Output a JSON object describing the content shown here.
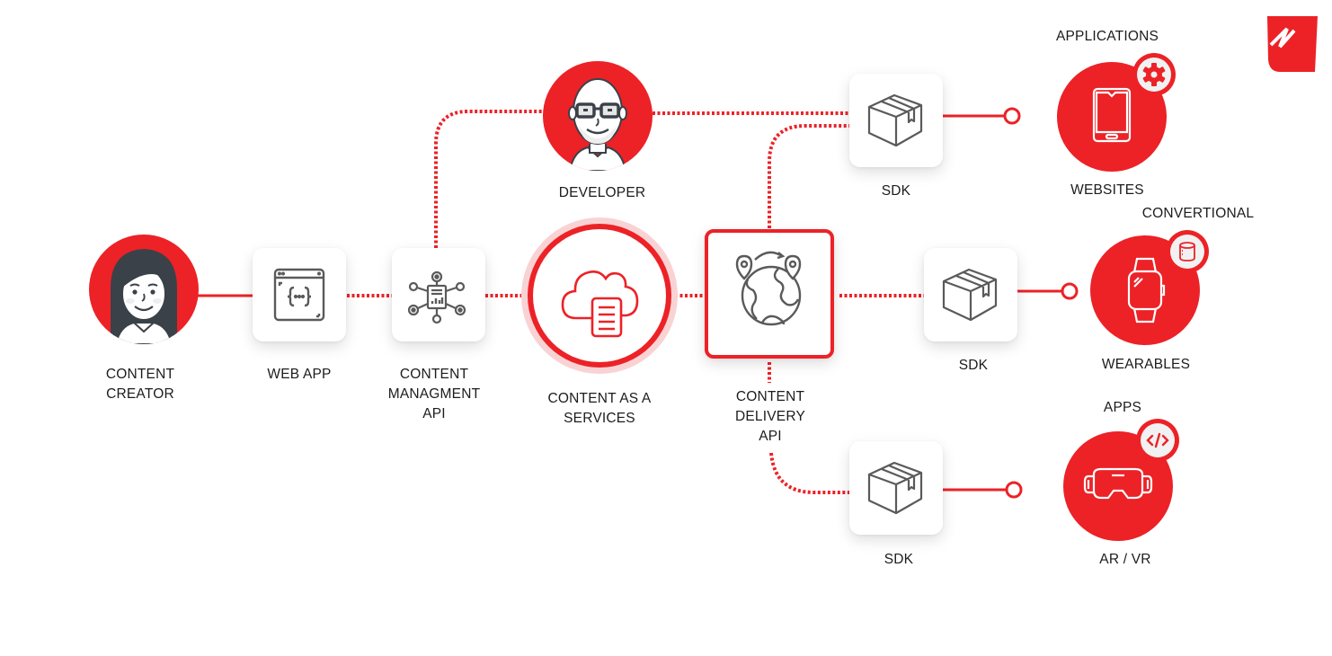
{
  "colors": {
    "accent": "#ec2227",
    "accent_light": "#f9d3d4",
    "icon_gray": "#5a5a5a",
    "badge_bg": "#f1f1f1"
  },
  "brand": {
    "logo_icon": "brand-logo-icon"
  },
  "nodes": {
    "content_creator": {
      "label": "CONTENT\nCREATOR",
      "icon": "woman-avatar-icon"
    },
    "web_app": {
      "label": "WEB APP",
      "icon": "browser-code-icon"
    },
    "content_management_api": {
      "label": "CONTENT\nMANAGMENT\nAPI",
      "icon": "network-document-icon"
    },
    "developer": {
      "label": "DEVELOPER",
      "icon": "man-avatar-icon"
    },
    "content_as_a_service": {
      "label": "CONTENT AS A\nSERVICES",
      "icon": "cloud-document-icon"
    },
    "content_delivery_api": {
      "label": "CONTENT\nDELIVERY\nAPI",
      "icon": "globe-locations-icon"
    },
    "sdk_top": {
      "label": "SDK",
      "icon": "package-box-icon"
    },
    "sdk_middle": {
      "label": "SDK",
      "icon": "package-box-icon"
    },
    "sdk_bottom": {
      "label": "SDK",
      "icon": "package-box-icon"
    },
    "websites": {
      "label": "WEBSITES",
      "category": "APPLICATIONS",
      "icon": "tablet-icon",
      "badge_icon": "gear-icon"
    },
    "wearables": {
      "label": "WEARABLES",
      "category": "CONVERTIONAL",
      "icon": "smartwatch-icon",
      "badge_icon": "database-icon"
    },
    "ar_vr": {
      "label": "AR / VR",
      "category": "APPS",
      "icon": "vr-headset-icon",
      "badge_icon": "code-tag-icon"
    }
  },
  "connections": [
    {
      "from": "content_creator",
      "to": "web_app",
      "style": "solid"
    },
    {
      "from": "web_app",
      "to": "content_management_api",
      "style": "dotted"
    },
    {
      "from": "content_management_api",
      "to": "content_as_a_service",
      "style": "dotted"
    },
    {
      "from": "content_management_api",
      "to": "developer",
      "style": "dotted"
    },
    {
      "from": "developer",
      "to": "sdk_top",
      "style": "dotted"
    },
    {
      "from": "content_as_a_service",
      "to": "content_delivery_api",
      "style": "dotted"
    },
    {
      "from": "content_delivery_api",
      "to": "sdk_top",
      "style": "dotted"
    },
    {
      "from": "content_delivery_api",
      "to": "sdk_middle",
      "style": "dotted"
    },
    {
      "from": "content_delivery_api",
      "to": "sdk_bottom",
      "style": "dotted"
    },
    {
      "from": "sdk_top",
      "to": "websites",
      "style": "solid"
    },
    {
      "from": "sdk_middle",
      "to": "wearables",
      "style": "solid"
    },
    {
      "from": "sdk_bottom",
      "to": "ar_vr",
      "style": "solid"
    }
  ]
}
